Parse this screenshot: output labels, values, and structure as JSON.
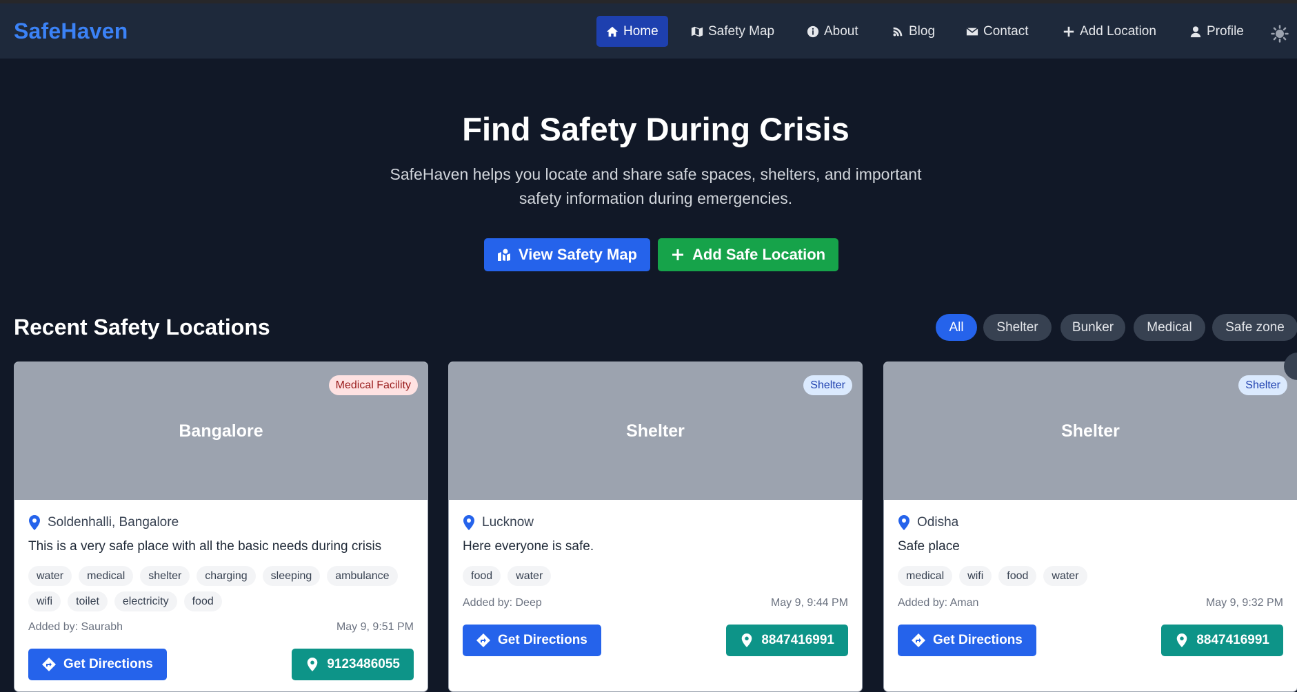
{
  "brand": "SafeHaven",
  "nav": {
    "home": "Home",
    "safety_map": "Safety Map",
    "about": "About",
    "blog": "Blog",
    "contact": "Contact",
    "add_location": "Add Location",
    "profile": "Profile"
  },
  "hero": {
    "title": "Find Safety During Crisis",
    "subtitle": "SafeHaven helps you locate and share safe spaces, shelters, and important safety information during emergencies.",
    "btn_map": "View Safety Map",
    "btn_add": "Add Safe Location"
  },
  "recent": {
    "title": "Recent Safety Locations",
    "filters": [
      "All",
      "Shelter",
      "Bunker",
      "Medical",
      "Safe zone"
    ]
  },
  "cards": [
    {
      "image_title": "Bangalore",
      "badge": "Medical Facility",
      "location": "Soldenhalli, Bangalore",
      "description": "This is a very safe place with all the basic needs during crisis",
      "tags": [
        "water",
        "medical",
        "shelter",
        "charging",
        "sleeping",
        "ambulance",
        "wifi",
        "toilet",
        "electricity",
        "food"
      ],
      "added_by": "Added by: Saurabh",
      "date": "May 9, 9:51 PM",
      "directions": "Get Directions",
      "phone": "9123486055"
    },
    {
      "image_title": "Shelter",
      "badge": "Shelter",
      "location": "Lucknow",
      "description": "Here everyone is safe.",
      "tags": [
        "food",
        "water"
      ],
      "added_by": "Added by: Deep",
      "date": "May 9, 9:44 PM",
      "directions": "Get Directions",
      "phone": "8847416991"
    },
    {
      "image_title": "Shelter",
      "badge": "Shelter",
      "location": "Odisha",
      "description": "Safe place",
      "tags": [
        "medical",
        "wifi",
        "food",
        "water"
      ],
      "added_by": "Added by: Aman",
      "date": "May 9, 9:32 PM",
      "directions": "Get Directions",
      "phone": "8847416991"
    }
  ],
  "colors": {
    "background": "#111827",
    "navbar": "#1e293b",
    "brand": "#3b82f6",
    "primary": "#2563eb",
    "success": "#16a34a",
    "teal": "#0d9488"
  }
}
